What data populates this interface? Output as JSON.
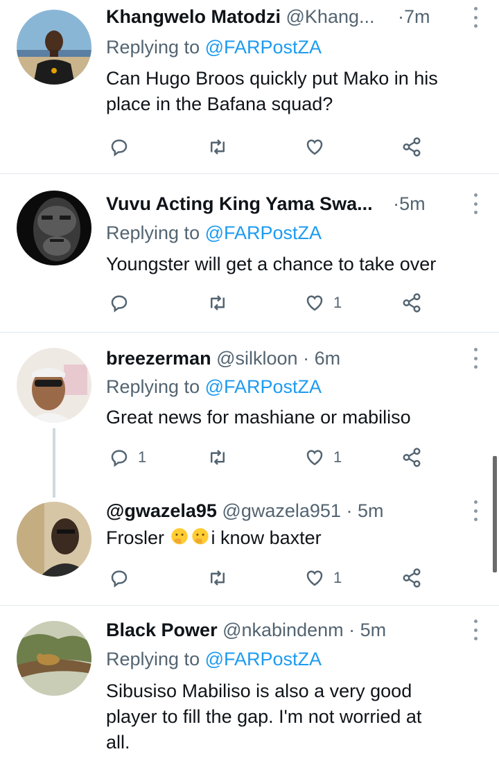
{
  "tweets": [
    {
      "name": "Khangwelo Matodzi",
      "handle": "@Khang...",
      "dot": "·",
      "time": "7m",
      "replying_prefix": "Replying to",
      "replying_to": "@FARPostZA",
      "text": "Can Hugo Broos quickly put Mako in his place in the Bafana squad?",
      "reply_count": "",
      "retweet_count": "",
      "like_count": ""
    },
    {
      "name": "Vuvu Acting King Yama Swa...",
      "handle": "",
      "dot": "·",
      "time": "5m",
      "replying_prefix": "Replying to",
      "replying_to": "@FARPostZA",
      "text": "Youngster will get a chance to take over",
      "reply_count": "",
      "retweet_count": "",
      "like_count": "1"
    },
    {
      "name": "breezerman",
      "handle": "@silkloon",
      "dot": "·",
      "time": "6m",
      "replying_prefix": "Replying to",
      "replying_to": "@FARPostZA",
      "text": "Great news for mashiane or mabiliso",
      "reply_count": "1",
      "retweet_count": "",
      "like_count": "1"
    },
    {
      "name": "@gwazela95",
      "handle": "@gwazela951",
      "dot": "·",
      "time": "5m",
      "text_before": "Frosler",
      "text_after": "i know baxter",
      "emoji": "face-with-hand-over-mouth",
      "reply_count": "",
      "retweet_count": "",
      "like_count": "1"
    },
    {
      "name": "Black Power",
      "handle": "@nkabindenm",
      "dot": "·",
      "time": "5m",
      "replying_prefix": "Replying to",
      "replying_to": "@FARPostZA",
      "text_lines": [
        "Sibusiso Mabiliso is also a very good",
        "player to fill the gap. I'm not worried at",
        "all."
      ]
    }
  ],
  "icons": {
    "reply": "reply-icon",
    "retweet": "retweet-icon",
    "like": "heart-icon",
    "share": "share-icon",
    "more": "more-options-icon"
  },
  "colors": {
    "link": "#1d9bf0",
    "secondary_text": "#536471",
    "primary_text": "#0f1419",
    "divider": "#e1e8ed"
  }
}
